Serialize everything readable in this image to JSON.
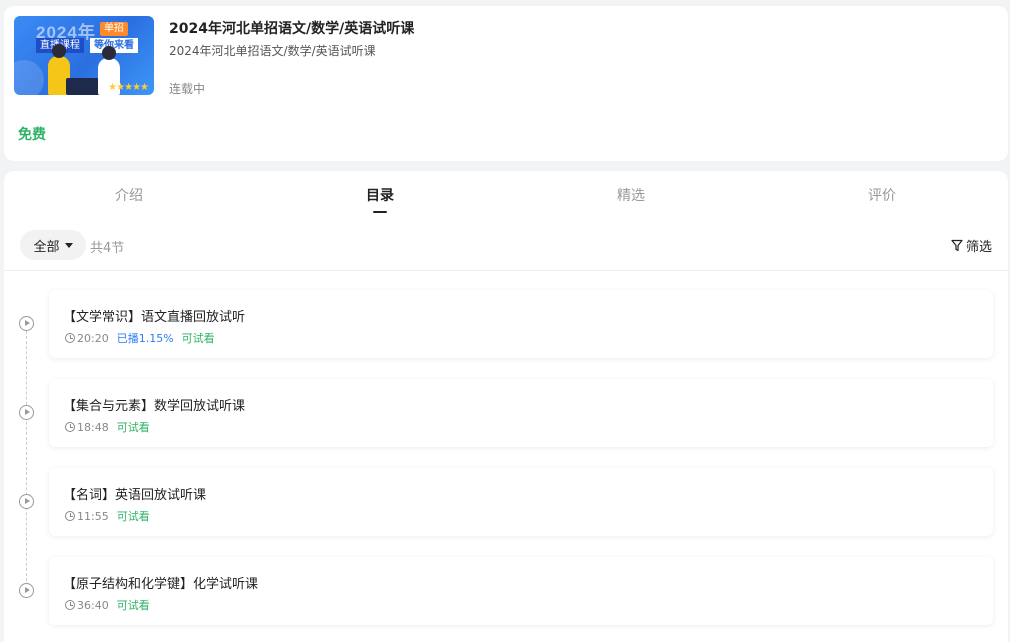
{
  "course": {
    "cover": {
      "year_text": "2024年",
      "tag_top": "单招",
      "tag_left": "直播课程",
      "tag_right": "等你来看",
      "rating_stars": "★★★★★"
    },
    "title": "2024年河北单招语文/数学/英语试听课",
    "subtitle": "2024年河北单招语文/数学/英语试听课",
    "status": "连载中",
    "price_label": "免费"
  },
  "tabs": [
    {
      "label": "介绍",
      "active": false
    },
    {
      "label": "目录",
      "active": true
    },
    {
      "label": "精选",
      "active": false
    },
    {
      "label": "评价",
      "active": false
    }
  ],
  "filter": {
    "all_label": "全部",
    "count_label": "共4节",
    "screen_label": "筛选"
  },
  "lessons": [
    {
      "title": "【文学常识】语文直播回放试听",
      "duration": "20:20",
      "progress": "已播1.15%",
      "trial": "可试看"
    },
    {
      "title": "【集合与元素】数学回放试听课",
      "duration": "18:48",
      "trial": "可试看"
    },
    {
      "title": "【名词】英语回放试听课",
      "duration": "11:55",
      "trial": "可试看"
    },
    {
      "title": "【原子结构和化学键】化学试听课",
      "duration": "36:40",
      "trial": "可试看"
    }
  ],
  "colors": {
    "accent_green": "#2fb266",
    "progress_blue": "#2f7cf6",
    "page_bg": "#f2f3f5"
  }
}
